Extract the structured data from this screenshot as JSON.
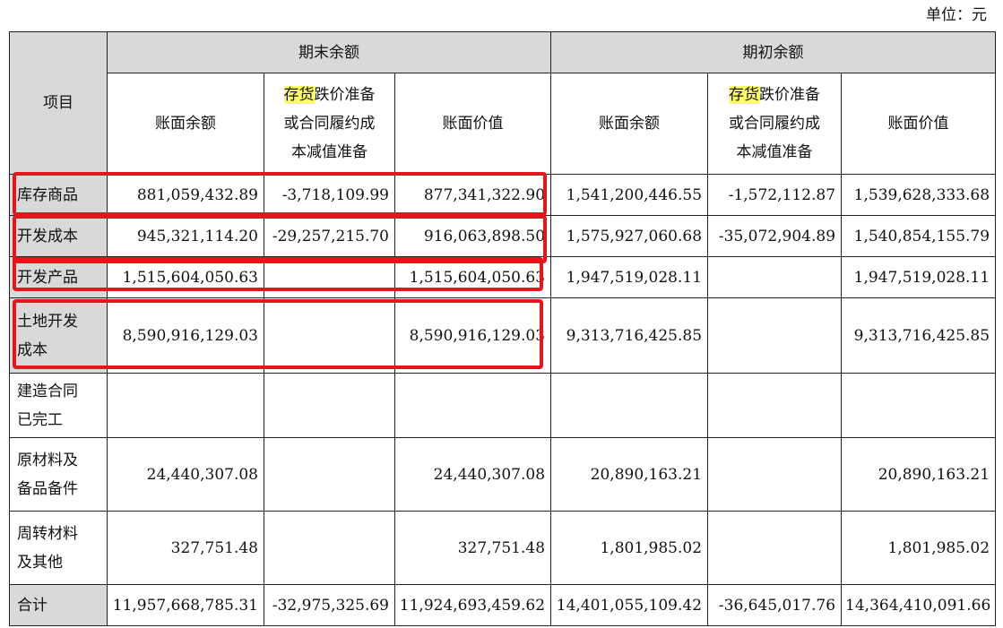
{
  "unit_label": "单位：元",
  "header": {
    "item": "项目",
    "period_end": "期末余额",
    "period_begin": "期初余额",
    "book_balance": "账面余额",
    "reserve_highlight": "存货",
    "reserve_rest_1": "跌价准备",
    "reserve_line_2": "或合同履约成",
    "reserve_line_3": "本减值准备",
    "book_value": "账面价值"
  },
  "rows": [
    {
      "item_1": "库存商品",
      "item_2": "",
      "end_balance": "881,059,432.89",
      "end_reserve": "-3,718,109.99",
      "end_value": "877,341,322.90",
      "begin_balance": "1,541,200,446.55",
      "begin_reserve": "-1,572,112.87",
      "begin_value": "1,539,628,333.68"
    },
    {
      "item_1": "开发成本",
      "item_2": "",
      "end_balance": "945,321,114.20",
      "end_reserve": "-29,257,215.70",
      "end_value": "916,063,898.50",
      "begin_balance": "1,575,927,060.68",
      "begin_reserve": "-35,072,904.89",
      "begin_value": "1,540,854,155.79"
    },
    {
      "item_1": "开发产品",
      "item_2": "",
      "end_balance": "1,515,604,050.63",
      "end_reserve": "",
      "end_value": "1,515,604,050.63",
      "begin_balance": "1,947,519,028.11",
      "begin_reserve": "",
      "begin_value": "1,947,519,028.11"
    },
    {
      "item_1": "土地开发",
      "item_2": "成本",
      "end_balance": "8,590,916,129.03",
      "end_reserve": "",
      "end_value": "8,590,916,129.03",
      "begin_balance": "9,313,716,425.85",
      "begin_reserve": "",
      "begin_value": "9,313,716,425.85"
    },
    {
      "item_1": "建造合同",
      "item_2": "已完工",
      "end_balance": "",
      "end_reserve": "",
      "end_value": "",
      "begin_balance": "",
      "begin_reserve": "",
      "begin_value": ""
    },
    {
      "item_1": "原材料及",
      "item_2": "备品备件",
      "end_balance": "24,440,307.08",
      "end_reserve": "",
      "end_value": "24,440,307.08",
      "begin_balance": "20,890,163.21",
      "begin_reserve": "",
      "begin_value": "20,890,163.21"
    },
    {
      "item_1": "周转材料",
      "item_2": "及其他",
      "end_balance": "327,751.48",
      "end_reserve": "",
      "end_value": "327,751.48",
      "begin_balance": "1,801,985.02",
      "begin_reserve": "",
      "begin_value": "1,801,985.02"
    }
  ],
  "total": {
    "item_1": "合计",
    "end_balance": "11,957,668,785.31",
    "end_reserve": "-32,975,325.69",
    "end_value": "11,924,693,459.62",
    "begin_balance": "14,401,055,109.42",
    "begin_reserve": "-36,645,017.76",
    "begin_value": "14,364,410,091.66"
  },
  "annotation_color": "#e8141c",
  "highlight_color": "#ffff66"
}
